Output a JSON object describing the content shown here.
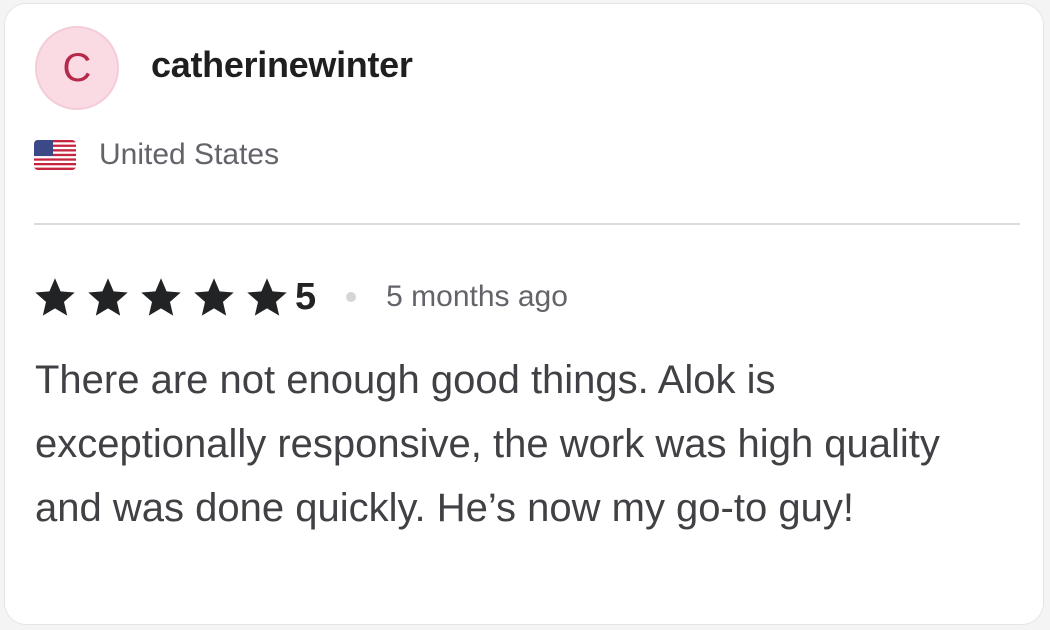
{
  "review": {
    "user": {
      "avatar_initial": "C",
      "username": "catherinewinter",
      "country": "United States",
      "flag_icon": "us-flag-icon"
    },
    "rating": {
      "stars": 5,
      "value": "5",
      "star_icon": "star-icon",
      "time_ago": "5 months ago"
    },
    "text": "There are not enough good things. Alok is exceptionally responsive, the work was high quality and was done quickly. He’s now my go-to guy!"
  },
  "colors": {
    "avatar_bg": "#fadbe4",
    "avatar_text": "#b52a4a",
    "star": "#222325",
    "muted_text": "#62646a",
    "body_text": "#404145"
  }
}
